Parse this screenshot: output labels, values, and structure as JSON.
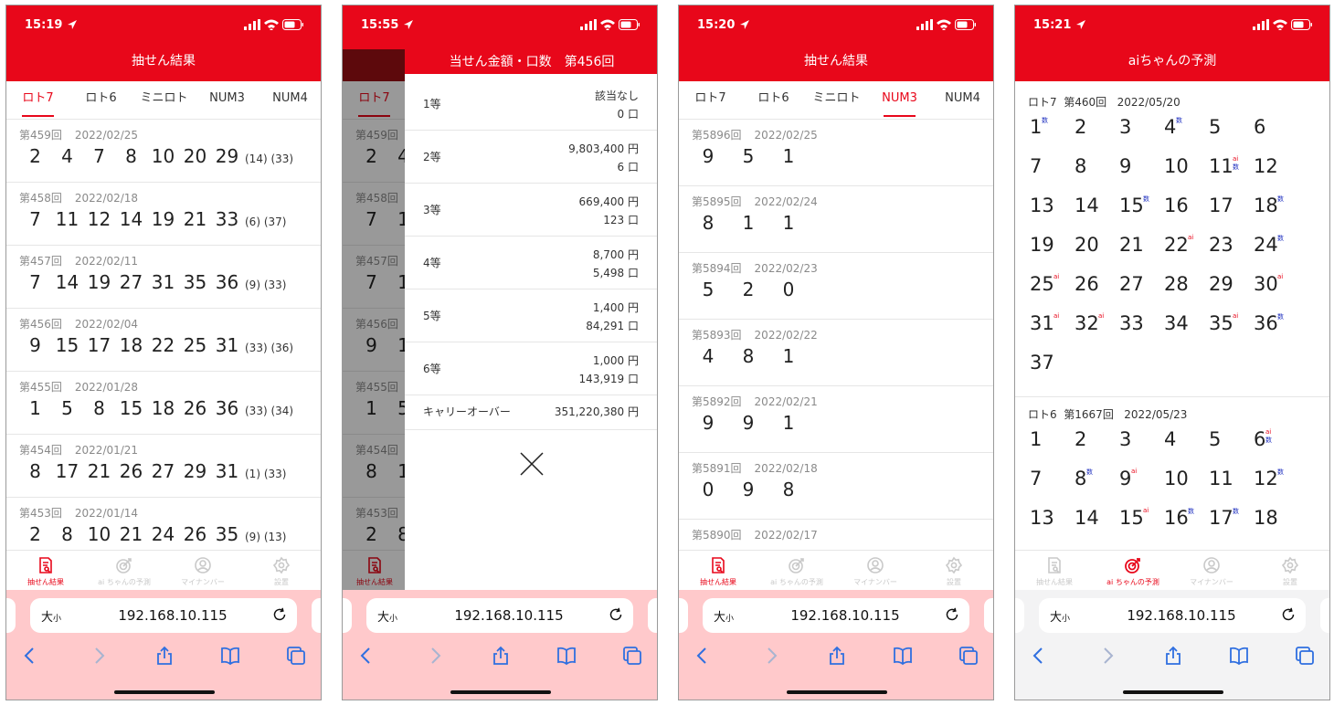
{
  "colors": {
    "brand_red": "#e8071a",
    "browser_tint": "#ffc9cb",
    "muted_text": "#8a8a8a",
    "ai_mark": "#e8071a",
    "su_mark": "#1e2fbf"
  },
  "browser": {
    "text_size_label": "大",
    "text_size_small": "小",
    "url": "192.168.10.115"
  },
  "nav": [
    "抽せん結果",
    "ai ちゃんの予測",
    "マイナンバー",
    "設置"
  ],
  "tabs": [
    "ロト7",
    "ロト6",
    "ミニロト",
    "NUM3",
    "NUM4"
  ],
  "phone1": {
    "time": "15:19",
    "title": "抽せん結果",
    "rows": [
      {
        "draw": "第459回",
        "date": "2022/02/25",
        "nums": [
          "2",
          "4",
          "7",
          "8",
          "10",
          "20",
          "29"
        ],
        "bonus": "(14) (33)"
      },
      {
        "draw": "第458回",
        "date": "2022/02/18",
        "nums": [
          "7",
          "11",
          "12",
          "14",
          "19",
          "21",
          "33"
        ],
        "bonus": "(6) (37)"
      },
      {
        "draw": "第457回",
        "date": "2022/02/11",
        "nums": [
          "7",
          "14",
          "19",
          "27",
          "31",
          "35",
          "36"
        ],
        "bonus": "(9) (33)"
      },
      {
        "draw": "第456回",
        "date": "2022/02/04",
        "nums": [
          "9",
          "15",
          "17",
          "18",
          "22",
          "25",
          "31"
        ],
        "bonus": "(33) (36)"
      },
      {
        "draw": "第455回",
        "date": "2022/01/28",
        "nums": [
          "1",
          "5",
          "8",
          "15",
          "18",
          "26",
          "36"
        ],
        "bonus": "(33) (34)"
      },
      {
        "draw": "第454回",
        "date": "2022/01/21",
        "nums": [
          "8",
          "17",
          "21",
          "26",
          "27",
          "29",
          "31"
        ],
        "bonus": "(1) (33)"
      },
      {
        "draw": "第453回",
        "date": "2022/01/14",
        "nums": [
          "2",
          "8",
          "10",
          "21",
          "24",
          "26",
          "35"
        ],
        "bonus": "(9) (13)"
      }
    ]
  },
  "phone2": {
    "time": "15:55",
    "under_tab": "ロト7",
    "under_rows": [
      {
        "draw": "第459回",
        "n1": "2",
        "n2": "4"
      },
      {
        "draw": "第458回",
        "n1": "7",
        "n2": "1"
      },
      {
        "draw": "第457回",
        "n1": "7",
        "n2": "1"
      },
      {
        "draw": "第456回",
        "n1": "9",
        "n2": "1"
      },
      {
        "draw": "第455回",
        "n1": "1",
        "n2": "5"
      },
      {
        "draw": "第454回",
        "n1": "8",
        "n2": "1"
      },
      {
        "draw": "第453回",
        "n1": "2",
        "n2": "8"
      }
    ],
    "modal_title": "当せん金額・口数　第456回",
    "prizes": [
      {
        "grade": "1等",
        "amount": "該当なし",
        "count": "0 口"
      },
      {
        "grade": "2等",
        "amount": "9,803,400 円",
        "count": "6 口"
      },
      {
        "grade": "3等",
        "amount": "669,400 円",
        "count": "123 口"
      },
      {
        "grade": "4等",
        "amount": "8,700 円",
        "count": "5,498 口"
      },
      {
        "grade": "5等",
        "amount": "1,400 円",
        "count": "84,291 口"
      },
      {
        "grade": "6等",
        "amount": "1,000 円",
        "count": "143,919 口"
      }
    ],
    "carry_label": "キャリーオーバー",
    "carry_value": "351,220,380 円"
  },
  "phone3": {
    "time": "15:20",
    "title": "抽せん結果",
    "rows": [
      {
        "draw": "第5896回",
        "date": "2022/02/25",
        "nums": [
          "9",
          "5",
          "1"
        ]
      },
      {
        "draw": "第5895回",
        "date": "2022/02/24",
        "nums": [
          "8",
          "1",
          "1"
        ]
      },
      {
        "draw": "第5894回",
        "date": "2022/02/23",
        "nums": [
          "5",
          "2",
          "0"
        ]
      },
      {
        "draw": "第5893回",
        "date": "2022/02/22",
        "nums": [
          "4",
          "8",
          "1"
        ]
      },
      {
        "draw": "第5892回",
        "date": "2022/02/21",
        "nums": [
          "9",
          "9",
          "1"
        ]
      },
      {
        "draw": "第5891回",
        "date": "2022/02/18",
        "nums": [
          "0",
          "9",
          "8"
        ]
      },
      {
        "draw": "第5890回",
        "date": "2022/02/17",
        "nums": []
      }
    ]
  },
  "phone4": {
    "time": "15:21",
    "title": "aiちゃんの予測",
    "mark_ai": "ai",
    "mark_su": "数",
    "sections": [
      {
        "game": "ロト7",
        "draw": "第460回",
        "date": "2022/05/20",
        "cells": [
          {
            "n": "1",
            "m": "su"
          },
          {
            "n": "2",
            "m": ""
          },
          {
            "n": "3",
            "m": ""
          },
          {
            "n": "4",
            "m": "su"
          },
          {
            "n": "5",
            "m": ""
          },
          {
            "n": "6",
            "m": ""
          },
          {
            "n": "7",
            "m": ""
          },
          {
            "n": "8",
            "m": ""
          },
          {
            "n": "9",
            "m": ""
          },
          {
            "n": "10",
            "m": ""
          },
          {
            "n": "11",
            "m": "both"
          },
          {
            "n": "12",
            "m": ""
          },
          {
            "n": "13",
            "m": ""
          },
          {
            "n": "14",
            "m": ""
          },
          {
            "n": "15",
            "m": "su"
          },
          {
            "n": "16",
            "m": ""
          },
          {
            "n": "17",
            "m": ""
          },
          {
            "n": "18",
            "m": "su"
          },
          {
            "n": "19",
            "m": ""
          },
          {
            "n": "20",
            "m": ""
          },
          {
            "n": "21",
            "m": ""
          },
          {
            "n": "22",
            "m": "ai"
          },
          {
            "n": "23",
            "m": ""
          },
          {
            "n": "24",
            "m": "su"
          },
          {
            "n": "25",
            "m": "ai"
          },
          {
            "n": "26",
            "m": ""
          },
          {
            "n": "27",
            "m": ""
          },
          {
            "n": "28",
            "m": ""
          },
          {
            "n": "29",
            "m": ""
          },
          {
            "n": "30",
            "m": "ai"
          },
          {
            "n": "31",
            "m": "ai"
          },
          {
            "n": "32",
            "m": "ai"
          },
          {
            "n": "33",
            "m": ""
          },
          {
            "n": "34",
            "m": ""
          },
          {
            "n": "35",
            "m": "ai"
          },
          {
            "n": "36",
            "m": "su"
          },
          {
            "n": "37",
            "m": ""
          }
        ]
      },
      {
        "game": "ロト6",
        "draw": "第1667回",
        "date": "2022/05/23",
        "cells": [
          {
            "n": "1",
            "m": ""
          },
          {
            "n": "2",
            "m": ""
          },
          {
            "n": "3",
            "m": ""
          },
          {
            "n": "4",
            "m": ""
          },
          {
            "n": "5",
            "m": ""
          },
          {
            "n": "6",
            "m": "both"
          },
          {
            "n": "7",
            "m": ""
          },
          {
            "n": "8",
            "m": "su"
          },
          {
            "n": "9",
            "m": "ai"
          },
          {
            "n": "10",
            "m": ""
          },
          {
            "n": "11",
            "m": ""
          },
          {
            "n": "12",
            "m": "su"
          },
          {
            "n": "13",
            "m": ""
          },
          {
            "n": "14",
            "m": ""
          },
          {
            "n": "15",
            "m": "ai"
          },
          {
            "n": "16",
            "m": "su"
          },
          {
            "n": "17",
            "m": "su"
          },
          {
            "n": "18",
            "m": ""
          }
        ]
      }
    ]
  }
}
